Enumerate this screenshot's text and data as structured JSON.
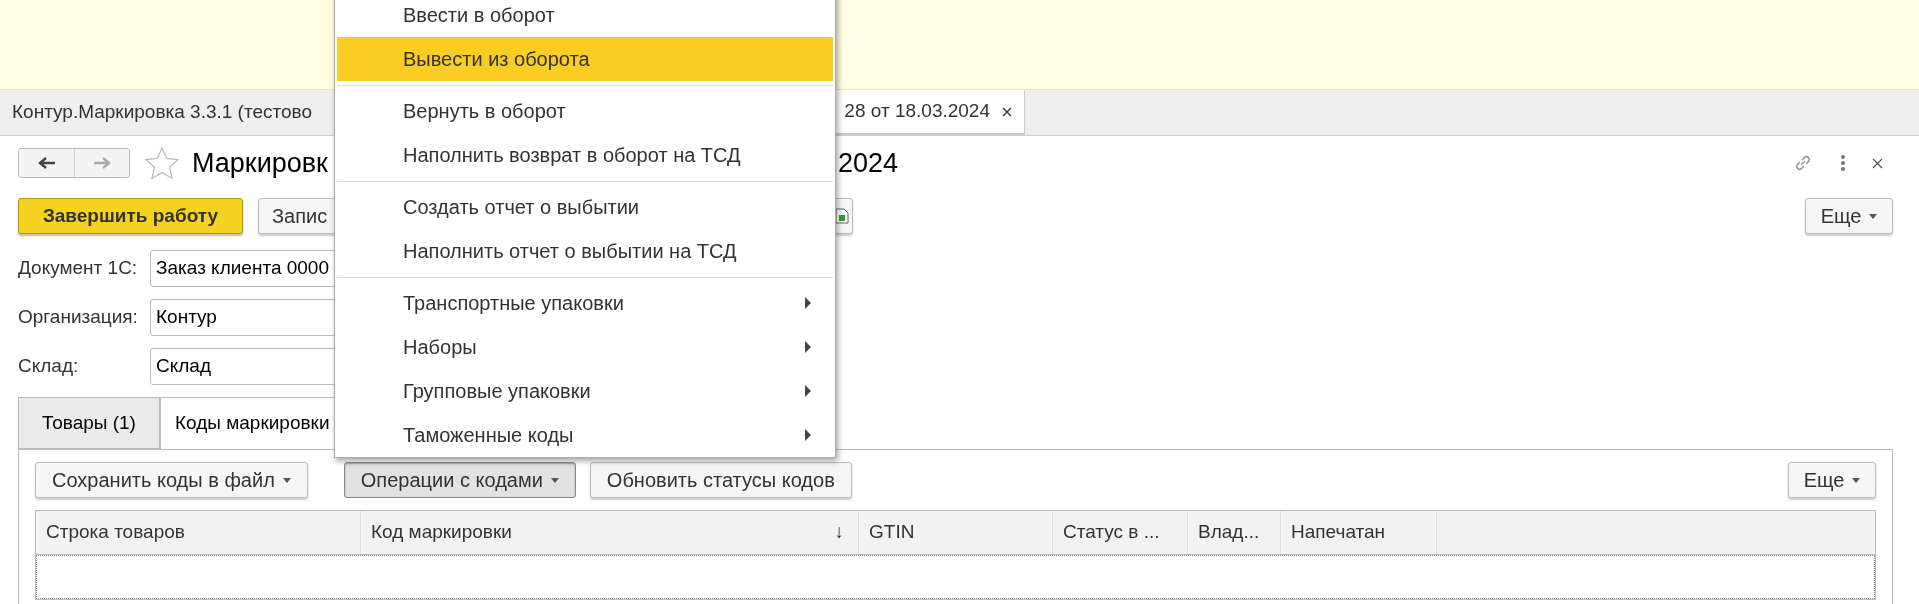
{
  "tabs": [
    {
      "label": "Контур.Маркировка 3.3.1 (тестово",
      "selected": false
    },
    {
      "label": "28 от 18.03.2024",
      "selected": true
    }
  ],
  "form": {
    "title_parts": [
      "Маркировк",
      "2024"
    ],
    "favorite": false
  },
  "toolbar": {
    "buttons": [
      {
        "label": "Завершить работу",
        "kind": "primary"
      },
      {
        "label": "Запис",
        "kind": "plain"
      },
      {
        "kind": "icon"
      }
    ],
    "more": "Еще"
  },
  "fields": [
    {
      "label": "Документ 1С:",
      "value": "Заказ клиента 0000"
    },
    {
      "label": "Организация:",
      "value": "Контур"
    },
    {
      "label": "Склад:",
      "value": "Склад"
    }
  ],
  "inner_tabs": [
    {
      "label": "Товары (1)",
      "selected": false
    },
    {
      "label": "Коды маркировки",
      "selected": true
    }
  ],
  "codes_toolbar": {
    "buttons": [
      {
        "label": "Сохранить коды в файл",
        "dropdown": true,
        "pressed": false
      },
      {
        "label": "Операции с кодами",
        "dropdown": true,
        "pressed": true
      },
      {
        "label": "Обновить статусы кодов",
        "dropdown": false,
        "pressed": false
      }
    ],
    "more": "Еще"
  },
  "table": {
    "columns": [
      {
        "label": "Строка товаров"
      },
      {
        "label": "Код маркировки",
        "sort_mark": "↓"
      },
      {
        "label": "GTIN"
      },
      {
        "label": "Статус в ..."
      },
      {
        "label": "Влад..."
      },
      {
        "label": "Напечатан"
      }
    ]
  },
  "menu": {
    "groups": [
      [
        {
          "label": "Ввести в оборот",
          "selected": false,
          "submenu": false
        },
        {
          "label": "Вывести из оборота",
          "selected": true,
          "submenu": false
        }
      ],
      [
        {
          "label": "Вернуть в оборот",
          "selected": false,
          "submenu": false
        },
        {
          "label": "Наполнить возврат в оборот на ТСД",
          "selected": false,
          "submenu": false
        }
      ],
      [
        {
          "label": "Создать отчет о выбытии",
          "selected": false,
          "submenu": false
        },
        {
          "label": "Наполнить отчет о выбытии на ТСД",
          "selected": false,
          "submenu": false
        }
      ],
      [
        {
          "label": "Транспортные упаковки",
          "selected": false,
          "submenu": true
        },
        {
          "label": "Наборы",
          "selected": false,
          "submenu": true
        },
        {
          "label": "Групповые упаковки",
          "selected": false,
          "submenu": true
        },
        {
          "label": "Таможенные коды",
          "selected": false,
          "submenu": true
        }
      ]
    ]
  }
}
